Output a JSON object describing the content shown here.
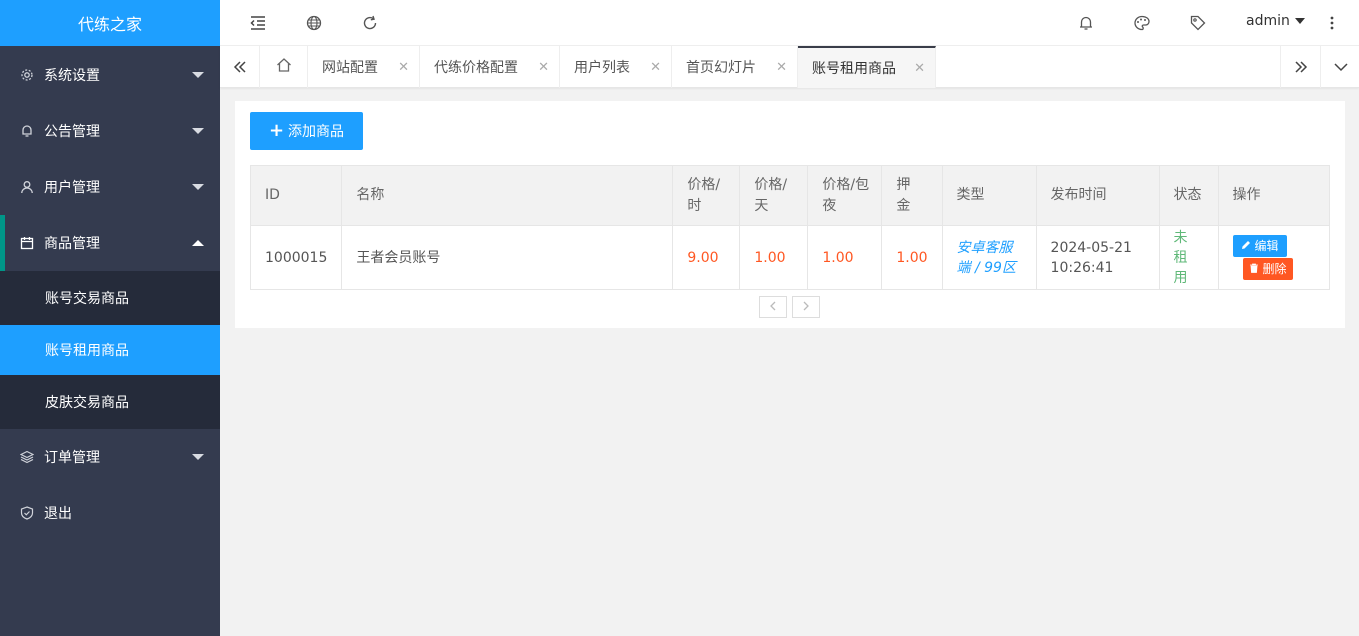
{
  "brand": {
    "title": "代练之家"
  },
  "colors": {
    "accent": "#1e9fff",
    "danger": "#ff5722",
    "success": "#5fb878",
    "sidebar": "#343b4f",
    "sidebar_sub": "#252b3a"
  },
  "sidebar": {
    "items": [
      {
        "label": "系统设置",
        "icon": "gear-icon"
      },
      {
        "label": "公告管理",
        "icon": "bell-icon"
      },
      {
        "label": "用户管理",
        "icon": "user-icon"
      },
      {
        "label": "商品管理",
        "icon": "calendar-icon",
        "children": [
          {
            "label": "账号交易商品"
          },
          {
            "label": "账号租用商品",
            "active": true
          },
          {
            "label": "皮肤交易商品"
          }
        ]
      },
      {
        "label": "订单管理",
        "icon": "layers-icon"
      },
      {
        "label": "退出",
        "icon": "shield-check-icon"
      }
    ]
  },
  "header": {
    "icons": [
      "indent-icon",
      "globe-icon",
      "refresh-icon",
      "bell-icon",
      "palette-icon",
      "tag-icon",
      "more-vertical-icon"
    ],
    "user": "admin"
  },
  "tabs": {
    "items": [
      {
        "label": "网站配置"
      },
      {
        "label": "代练价格配置"
      },
      {
        "label": "用户列表"
      },
      {
        "label": "首页幻灯片"
      },
      {
        "label": "账号租用商品",
        "active": true
      }
    ]
  },
  "content": {
    "add_button": "添加商品",
    "table": {
      "headers": {
        "id": "ID",
        "name": "名称",
        "price_hour": "价格/时",
        "price_day": "价格/天",
        "price_night": "价格/包夜",
        "deposit": "押金",
        "type": "类型",
        "publish_time": "发布时间",
        "status": "状态",
        "actions": "操作"
      },
      "rows": [
        {
          "id": "1000015",
          "name": "王者会员账号",
          "price_hour": "9.00",
          "price_day": "1.00",
          "price_night": "1.00",
          "deposit": "1.00",
          "type": "安卓客服端 / 99区",
          "publish_date": "2024-05-21",
          "publish_time": "10:26:41",
          "status": "未租用",
          "edit": "编辑",
          "delete": "删除"
        }
      ]
    }
  }
}
